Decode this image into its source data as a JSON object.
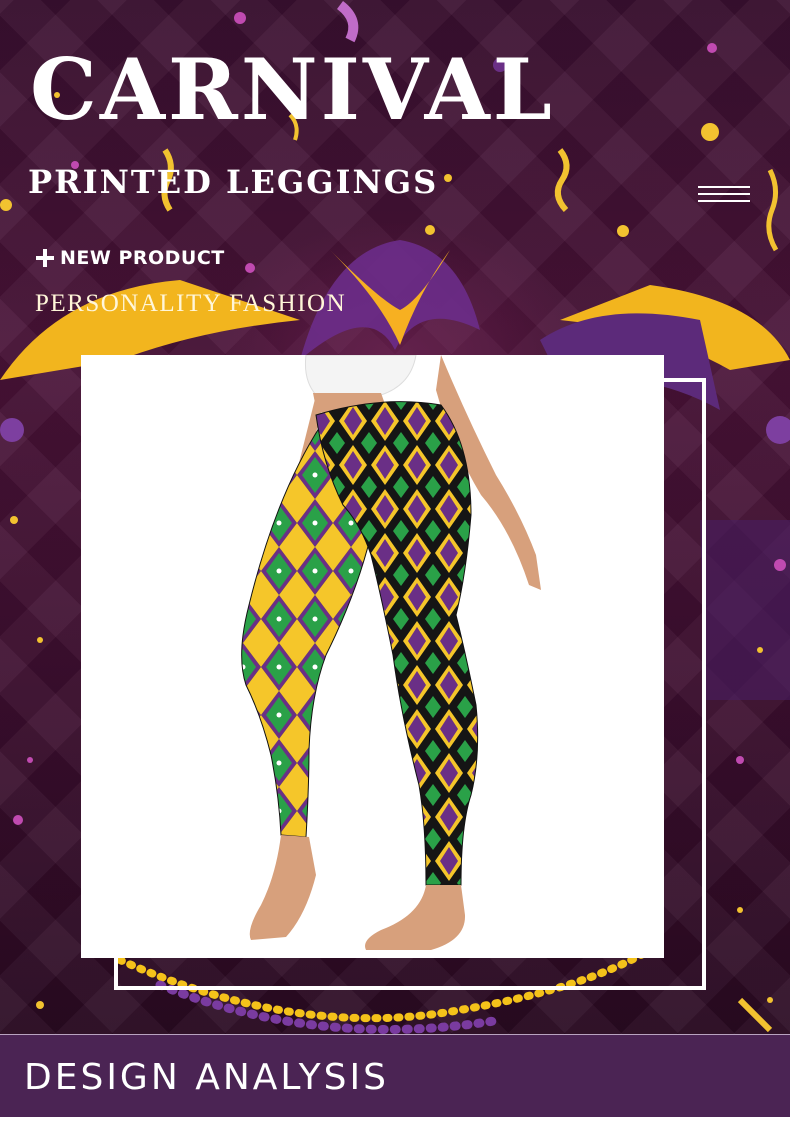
{
  "hero": {
    "title": "CARNIVAL",
    "subtitle": "PRINTED LEGGINGS",
    "new_product": "NEW PRODUCT",
    "tagline": "PERSONALITY FASHION"
  },
  "footer": {
    "title": "DESIGN ANALYSIS"
  },
  "icons": {
    "menu": "hamburger-menu-icon",
    "plus": "plus-icon"
  },
  "colors": {
    "background": "#3a1030",
    "purple": "#6a2f86",
    "gold": "#f5c62a",
    "green": "#2aa148",
    "footer_band": "#4b2454"
  }
}
